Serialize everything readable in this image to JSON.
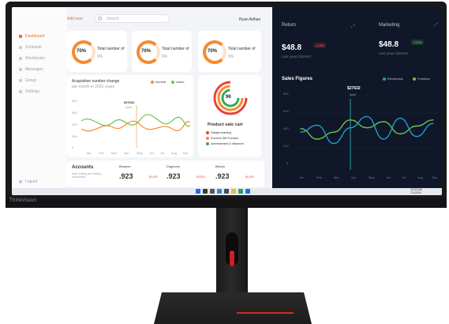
{
  "app": {
    "left_tag": "Add new",
    "search_placeholder": "Search",
    "user_name": "Ryan Adhan"
  },
  "sidebar": {
    "items": [
      {
        "label": "Dashboard",
        "active": true
      },
      {
        "label": "Schedule"
      },
      {
        "label": "Workbooks"
      },
      {
        "label": "Messages"
      },
      {
        "label": "Group"
      },
      {
        "label": "Settings"
      }
    ],
    "logout": "Logout"
  },
  "kpis": [
    {
      "percent": "70%",
      "title": "Total number of",
      "sub": "9%"
    },
    {
      "percent": "70%",
      "title": "Total number of",
      "sub": "9%"
    },
    {
      "percent": "70%",
      "title": "Total number of",
      "sub": "9%"
    }
  ],
  "acquisition": {
    "title": "Acquisition number change",
    "subtitle": "per month in 2026 years",
    "legend": [
      "Income",
      "Users"
    ],
    "tooltip_value": "$27632",
    "tooltip_month": "April",
    "x_labels": [
      "Jan",
      "Feb",
      "Mar",
      "Apr",
      "May",
      "Jun",
      "Jul",
      "Aug",
      "Sep"
    ],
    "y_labels": [
      "800",
      "600",
      "400",
      "200",
      "0"
    ]
  },
  "product": {
    "center": "96",
    "title": "Product sale cart",
    "items": [
      "Gadget branding",
      "Souvenir Gift Products",
      "Advertisement & Influencer"
    ],
    "colors": [
      "#e8433a",
      "#f7892e",
      "#2eaa5e"
    ]
  },
  "accounts": {
    "title": "Accounts",
    "subtitle": "Start trading and finding accountsss",
    "coins": [
      {
        "name": "Binance",
        "value": ".923",
        "change": "$4,520"
      },
      {
        "name": "Dogecoin",
        "value": ".923",
        "change": "$4,520"
      },
      {
        "name": "Bitcoin",
        "value": ".923",
        "change": "$4,520"
      }
    ]
  },
  "return_card": {
    "title": "Return",
    "value": "$48.8",
    "tag": "-3.5%",
    "sub": "Last years $32640"
  },
  "marketing_card": {
    "title": "Marketing",
    "value": "$48.8",
    "tag": "+12%",
    "sub": "Last years $32640"
  },
  "sales": {
    "title": "Sales Figures",
    "legend": [
      "Electronics",
      "Furniture"
    ],
    "tooltip_value": "$27632",
    "tooltip_month": "April",
    "x_labels": [
      "Jan",
      "Feb",
      "Mar",
      "Apr",
      "May",
      "Jun",
      "Jul",
      "Aug",
      "Sep"
    ],
    "y_labels": [
      "800",
      "600",
      "400",
      "200",
      "0"
    ]
  },
  "taskbar": {
    "time": "10:02 AM",
    "date": "7/1/2024"
  },
  "brand": {
    "name": "ThinkVision"
  },
  "chart_data": [
    {
      "type": "line",
      "title": "Sales Figures",
      "categories": [
        "Jan",
        "Feb",
        "Mar",
        "Apr",
        "May",
        "Jun",
        "Jul",
        "Aug",
        "Sep"
      ],
      "ylim": [
        0,
        800
      ],
      "series": [
        {
          "name": "Electronics",
          "values": [
            420,
            300,
            380,
            520,
            430,
            500,
            360,
            450,
            520
          ]
        },
        {
          "name": "Furniture",
          "values": [
            380,
            460,
            250,
            430,
            560,
            300,
            540,
            330,
            480
          ]
        }
      ],
      "colors": [
        "#6fc24a",
        "#1fa0c8"
      ]
    }
  ]
}
